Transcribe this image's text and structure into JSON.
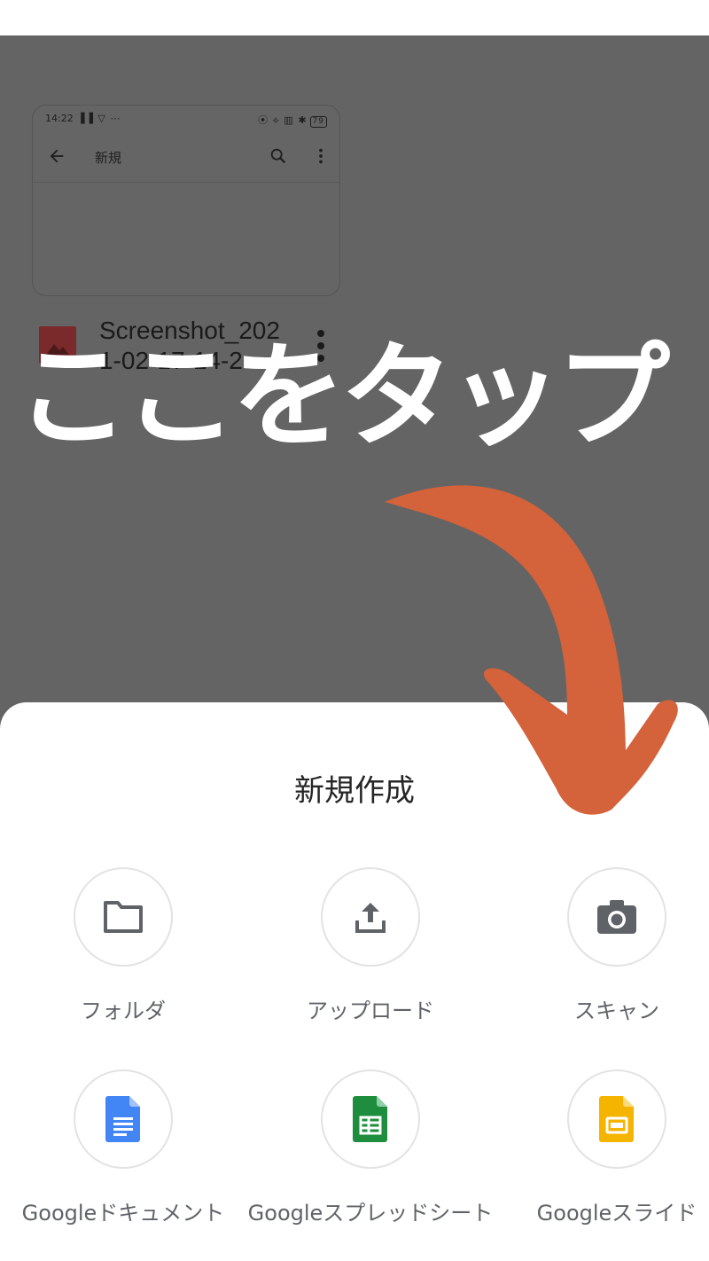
{
  "preview": {
    "status_time": "14:22",
    "status_left_icons": "▐▐ ▽ ⋯",
    "status_right_icons": "⦿ ⟡ ▥ ✱",
    "battery": "79",
    "app_bar_title": "新規"
  },
  "file": {
    "name": "Screenshot_2021-02-17-14-2"
  },
  "overlay": {
    "text": "ここをタップ"
  },
  "sheet": {
    "title": "新規作成",
    "actions": [
      {
        "label": "フォルダ",
        "icon": "folder-icon"
      },
      {
        "label": "アップロード",
        "icon": "upload-icon"
      },
      {
        "label": "スキャン",
        "icon": "camera-icon"
      },
      {
        "label": "Googleドキュメント",
        "icon": "google-docs-icon"
      },
      {
        "label": "Googleスプレッドシート",
        "icon": "google-sheets-icon"
      },
      {
        "label": "Googleスライド",
        "icon": "google-slides-icon"
      }
    ]
  },
  "colors": {
    "dim_overlay": "#646464",
    "arrow": "#d4623a",
    "docs_blue": "#4285f4",
    "sheets_green": "#1e8e3e",
    "slides_yellow": "#f4b400",
    "icon_grey": "#5f6368"
  }
}
